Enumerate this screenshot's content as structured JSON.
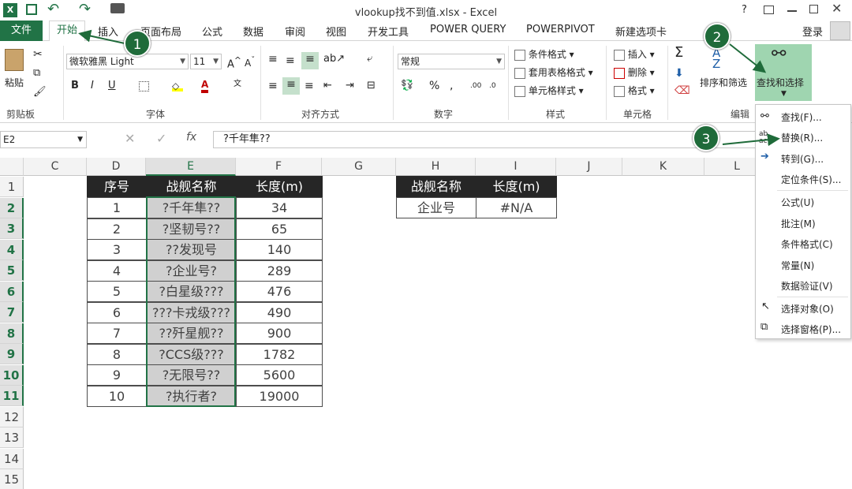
{
  "window": {
    "title": "vlookup找不到值.xlsx - Excel",
    "help": "?",
    "login": "登录"
  },
  "tabs": [
    "文件",
    "开始",
    "插入",
    "页面布局",
    "公式",
    "数据",
    "审阅",
    "视图",
    "开发工具",
    "POWER QUERY",
    "POWERPIVOT",
    "新建选项卡"
  ],
  "ribbon": {
    "paste": "粘贴",
    "clipboard": "剪贴板",
    "font_name": "微软雅黑 Light",
    "font_size": "11",
    "font_group": "字体",
    "bold": "B",
    "italic": "I",
    "underline": "U",
    "align_group": "对齐方式",
    "number_format": "常规",
    "number_group": "数字",
    "percent": "%",
    "comma": ",",
    "cond_format": "条件格式",
    "table_format": "套用表格格式",
    "cell_style": "单元格样式",
    "style_group": "样式",
    "insert": "插入",
    "delete": "删除",
    "format": "格式",
    "cells_group": "单元格",
    "sort_filter": "排序和筛选",
    "find_select": "查找和选择",
    "edit_group": "编辑"
  },
  "formula_bar": {
    "name_box": "E2",
    "fx": "fx",
    "value": "?千年隼??"
  },
  "columns": [
    "C",
    "D",
    "E",
    "F",
    "G",
    "H",
    "I",
    "J",
    "K",
    "L"
  ],
  "rows": [
    "1",
    "2",
    "3",
    "4",
    "5",
    "6",
    "7",
    "8",
    "9",
    "10",
    "11",
    "12",
    "13",
    "14",
    "15"
  ],
  "table1": {
    "headers": [
      "序号",
      "战舰名称",
      "长度(m)"
    ],
    "rows": [
      [
        "1",
        "?千年隼??",
        "34"
      ],
      [
        "2",
        "?坚韧号??",
        "65"
      ],
      [
        "3",
        "??发现号",
        "140"
      ],
      [
        "4",
        "?企业号?",
        "289"
      ],
      [
        "5",
        "?白星级???",
        "476"
      ],
      [
        "6",
        "???卡戎级???",
        "490"
      ],
      [
        "7",
        "??歼星舰??",
        "900"
      ],
      [
        "8",
        "?CCS级???",
        "1782"
      ],
      [
        "9",
        "?无限号??",
        "5600"
      ],
      [
        "10",
        "?执行者?",
        "19000"
      ]
    ]
  },
  "table2": {
    "headers": [
      "战舰名称",
      "长度(m)"
    ],
    "row": [
      "企业号",
      "#N/A"
    ]
  },
  "menu": [
    "查找(F)...",
    "替换(R)...",
    "转到(G)...",
    "定位条件(S)...",
    "公式(U)",
    "批注(M)",
    "条件格式(C)",
    "常量(N)",
    "数据验证(V)",
    "选择对象(O)",
    "选择窗格(P)..."
  ],
  "badges": [
    "1",
    "2",
    "3"
  ],
  "colors": {
    "excel_green": "#217346",
    "header_dark": "#262626",
    "selected_fill": "#d0d0d0"
  }
}
